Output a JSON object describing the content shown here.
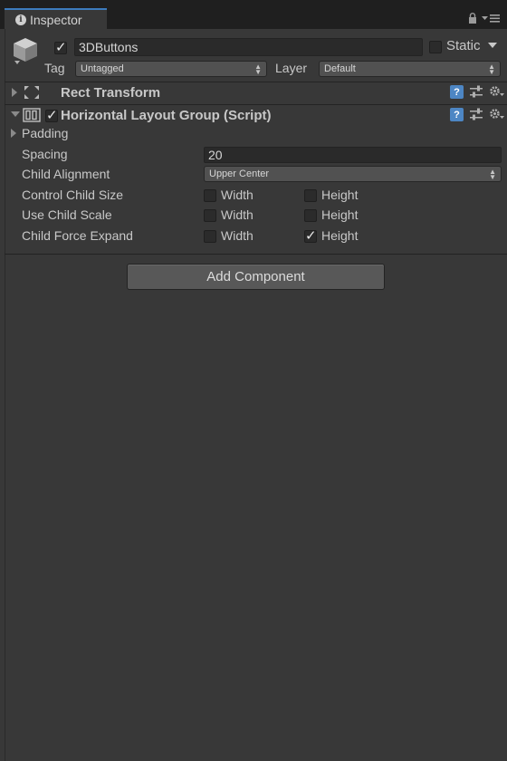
{
  "window": {
    "tab_label": "Inspector"
  },
  "object": {
    "active": true,
    "name": "3DButtons",
    "static_label": "Static",
    "static_checked": false,
    "tag_label": "Tag",
    "tag_value": "Untagged",
    "layer_label": "Layer",
    "layer_value": "Default"
  },
  "components": [
    {
      "name": "Rect Transform",
      "expanded": false
    },
    {
      "name": "Horizontal Layout Group (Script)",
      "expanded": true,
      "enabled": true
    }
  ],
  "layout_group": {
    "padding_label": "Padding",
    "spacing_label": "Spacing",
    "spacing_value": "20",
    "child_alignment_label": "Child Alignment",
    "child_alignment_value": "Upper Center",
    "control_child_size": {
      "label": "Control Child Size",
      "width_label": "Width",
      "width": false,
      "height_label": "Height",
      "height": false
    },
    "use_child_scale": {
      "label": "Use Child Scale",
      "width_label": "Width",
      "width": false,
      "height_label": "Height",
      "height": false
    },
    "child_force_expand": {
      "label": "Child Force Expand",
      "width_label": "Width",
      "width": false,
      "height_label": "Height",
      "height": true
    }
  },
  "add_component_label": "Add Component",
  "icons": {
    "tab": "info-icon",
    "lock": "lock-icon",
    "menu": "context-menu-icon",
    "object": "cube-icon",
    "rect_transform": "move-icon",
    "layout_group": "horizontal-layout-icon",
    "help": "help-icon",
    "preset": "sliders-icon",
    "settings": "gear-icon"
  },
  "colors": {
    "background": "#383838",
    "tab_accent": "#3d7bbd",
    "help_icon": "#4d86c4"
  }
}
